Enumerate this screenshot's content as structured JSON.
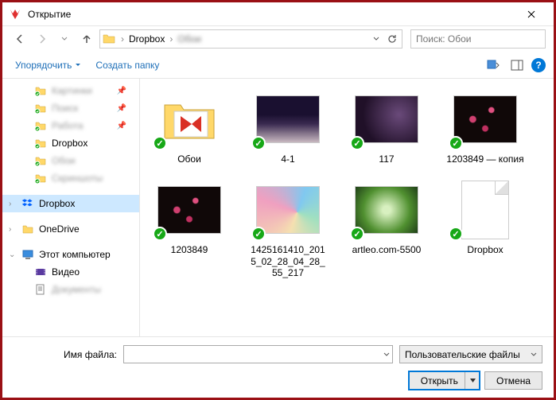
{
  "window": {
    "title": "Открытие"
  },
  "breadcrumb": {
    "segments": [
      "Dropbox",
      "Обои"
    ]
  },
  "search": {
    "placeholder": "Поиск: Обои"
  },
  "toolbar": {
    "organize": "Упорядочить",
    "new_folder": "Создать папку"
  },
  "sidebar": {
    "items1": [
      {
        "label": "Картинки",
        "pinned": true,
        "blur": true
      },
      {
        "label": "Поиск",
        "pinned": true,
        "blur": true
      },
      {
        "label": "Работа",
        "pinned": true,
        "blur": true
      },
      {
        "label": "Dropbox",
        "pinned": false,
        "blur": false
      },
      {
        "label": "Обои",
        "pinned": false,
        "blur": true
      },
      {
        "label": "Скриншоты",
        "pinned": false,
        "blur": true
      }
    ],
    "dropbox": "Dropbox",
    "onedrive": "OneDrive",
    "this_pc": "Этот компьютер",
    "video": "Видео",
    "docs": "Документы"
  },
  "files": [
    {
      "label": "Обои",
      "type": "folder"
    },
    {
      "label": "4-1",
      "type": "image",
      "bg": "bg-night1"
    },
    {
      "label": "117",
      "type": "image",
      "bg": "bg-night2"
    },
    {
      "label": "1203849 — копия",
      "type": "image",
      "bg": "bg-flowers"
    },
    {
      "label": "1203849",
      "type": "image",
      "bg": "bg-flowers"
    },
    {
      "label": "1425161410_2015_02_28_04_28_55_217",
      "type": "image",
      "bg": "bg-swirl"
    },
    {
      "label": "artleo.com-5500",
      "type": "image",
      "bg": "bg-green"
    },
    {
      "label": "Dropbox",
      "type": "blank"
    }
  ],
  "footer": {
    "fname_label": "Имя файла:",
    "filter": "Пользовательские файлы",
    "open": "Открыть",
    "cancel": "Отмена"
  }
}
